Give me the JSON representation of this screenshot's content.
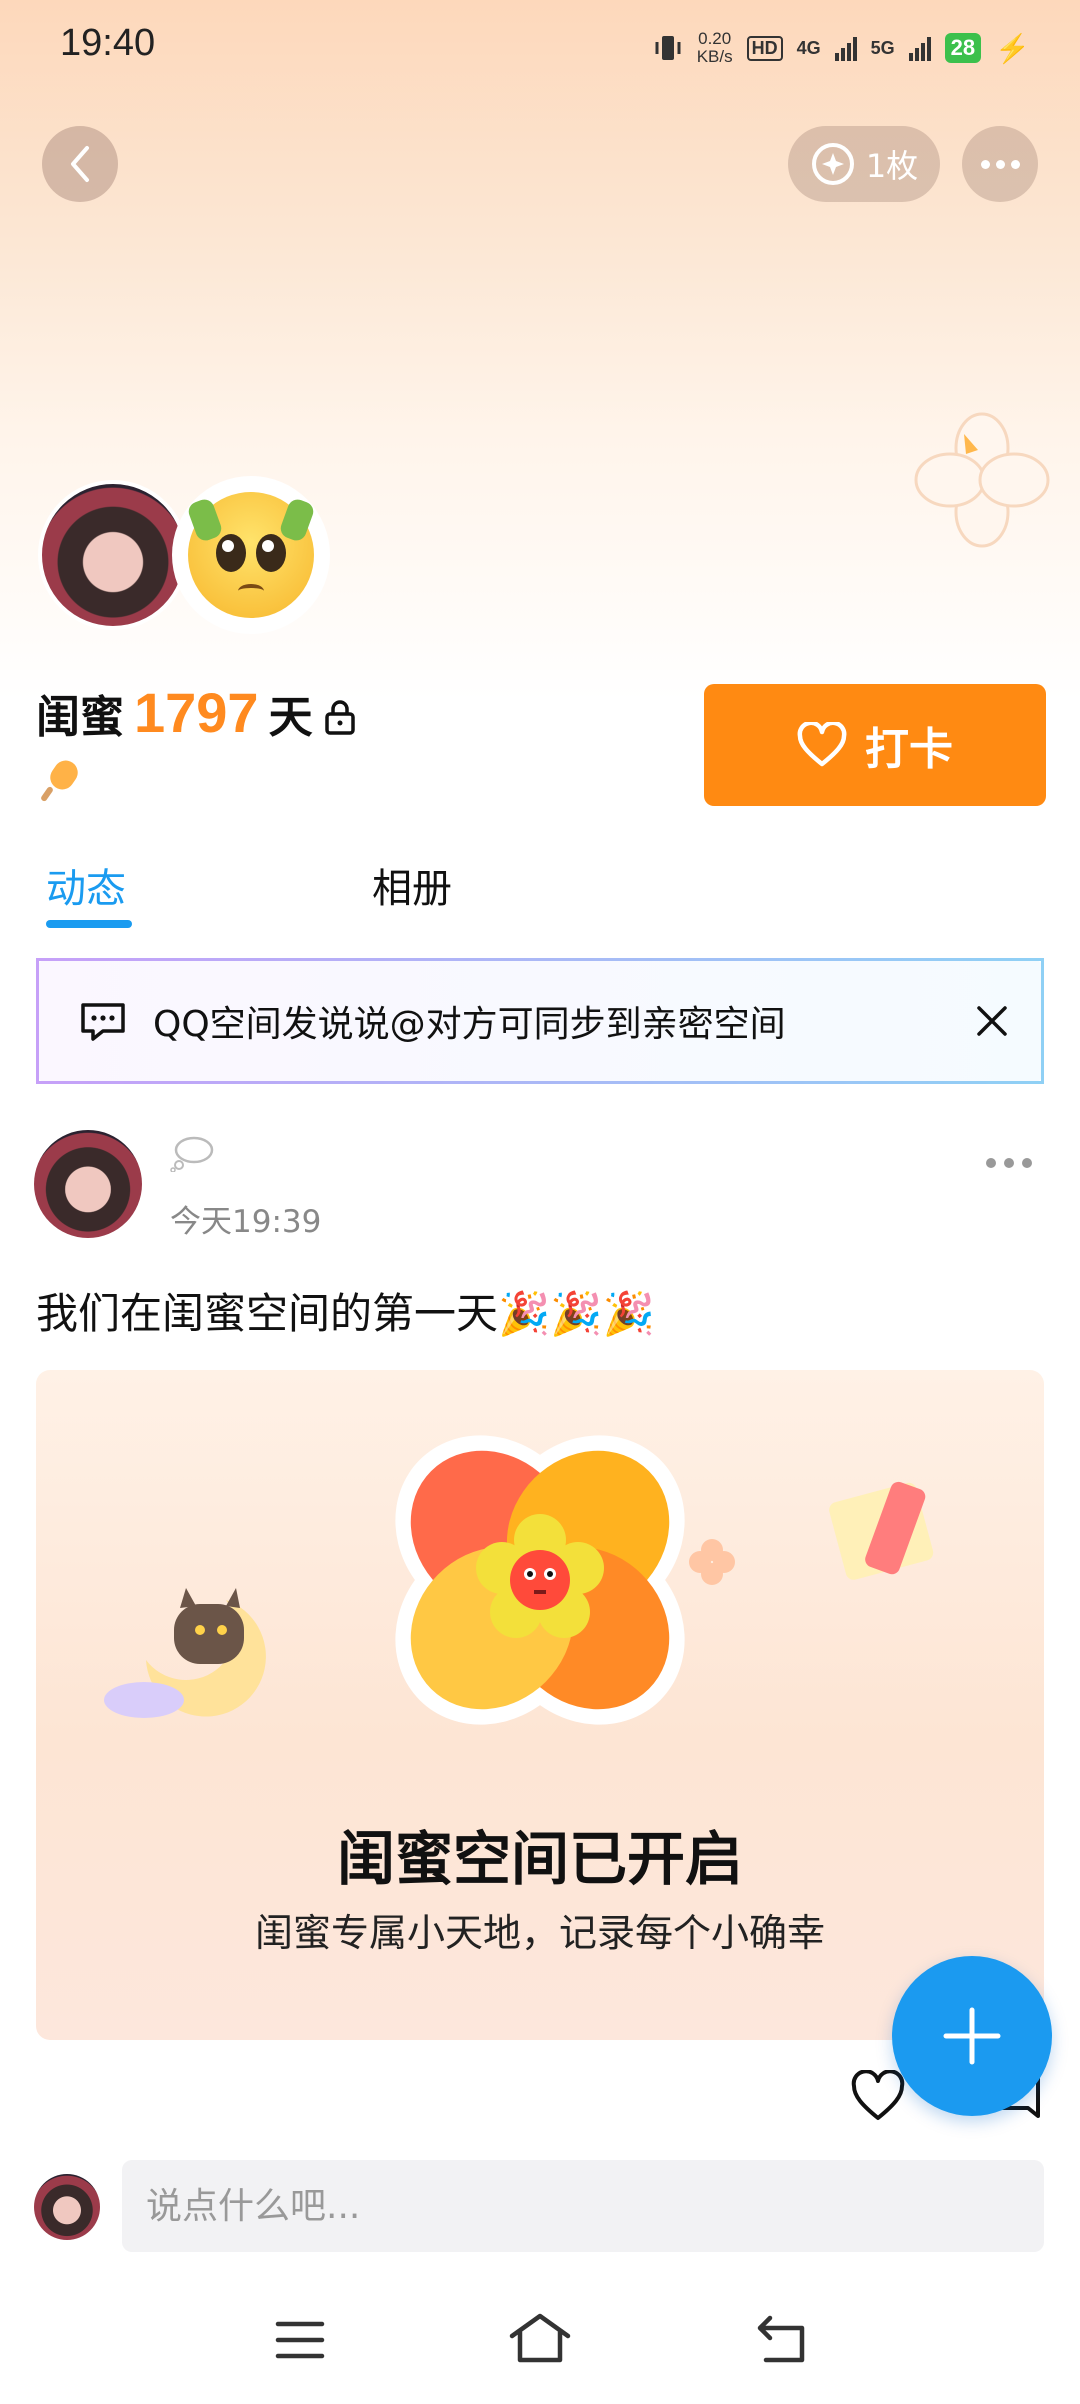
{
  "status_bar": {
    "time": "19:40",
    "net_speed_value": "0.20",
    "net_speed_unit": "KB/s",
    "hd_label": "HD",
    "sim1_label": "4G",
    "sim2_label": "5G",
    "battery": "28"
  },
  "header": {
    "badge_count": "1枚"
  },
  "profile": {
    "relation": "闺蜜",
    "days": "1797",
    "days_unit": "天",
    "checkin_label": "打卡"
  },
  "tabs": [
    {
      "label": "动态",
      "active": true
    },
    {
      "label": "相册",
      "active": false
    }
  ],
  "tip": {
    "text": "QQ空间发说说@对方可同步到亲密空间"
  },
  "post": {
    "time": "今天19:39",
    "text": "我们在闺蜜空间的第一天🎉🎉🎉",
    "card_title": "闺蜜空间已开启",
    "card_subtitle": "闺蜜专属小天地，记录每个小确幸"
  },
  "comment": {
    "placeholder": "说点什么吧..."
  },
  "colors": {
    "accent_orange": "#ff8a12",
    "accent_blue": "#1a9bf0"
  }
}
